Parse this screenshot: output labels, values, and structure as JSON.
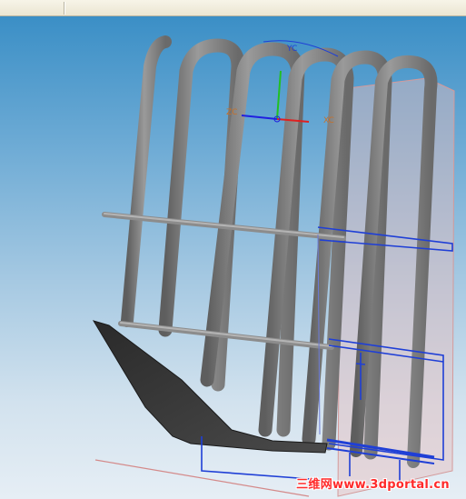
{
  "viewport": {
    "background_top": "#3b8fc6",
    "background_bottom": "#e6eef5"
  },
  "triad": {
    "yc_label": "YC",
    "xc_label": "XC",
    "zc_label": "ZC",
    "x_color": "#e02020",
    "y_color": "#20c020",
    "z_color": "#2020e0",
    "label_color": "#c87028"
  },
  "model": {
    "body_color": "#7a7a7a",
    "highlight_color": "#a8a8a8",
    "sketch_color": "#1f3fd6",
    "datum_plane_color": "#e3b6b6"
  },
  "watermark": {
    "text": "三维网www.3dportal.cn"
  }
}
